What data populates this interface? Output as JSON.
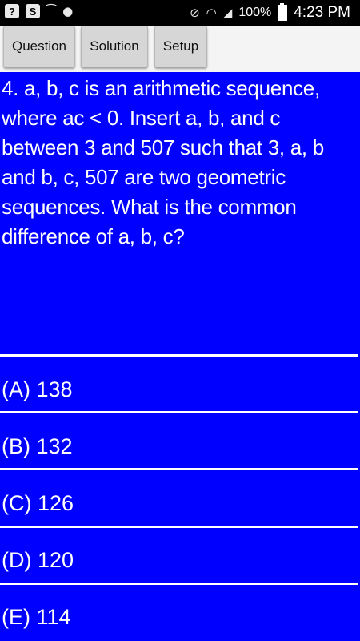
{
  "status_bar": {
    "battery_text": "100%",
    "time": "4:23 PM",
    "icons": [
      "help-box-icon",
      "s-app-icon",
      "voicemail-icon",
      "brush-icon",
      "mute-icon",
      "wifi-icon",
      "signal-icon",
      "battery-icon"
    ]
  },
  "toolbar": {
    "question_label": "Question",
    "solution_label": "Solution",
    "setup_label": "Setup"
  },
  "question": {
    "text": "4. a, b, c is an arithmetic sequence, where ac < 0. Insert a, b, and c between 3 and 507 such that 3, a, b and b, c, 507 are two geometric sequences. What is the common difference of a, b, c?"
  },
  "answers": [
    {
      "label": "(A) 138"
    },
    {
      "label": "(B) 132"
    },
    {
      "label": "(C) 126"
    },
    {
      "label": "(D) 120"
    },
    {
      "label": "(E) 114"
    }
  ],
  "colors": {
    "background": "#0000ff",
    "text": "#ffffff",
    "divider": "#ffffff",
    "toolbar": "#f4f4f4",
    "button": "#d6d6d6"
  }
}
